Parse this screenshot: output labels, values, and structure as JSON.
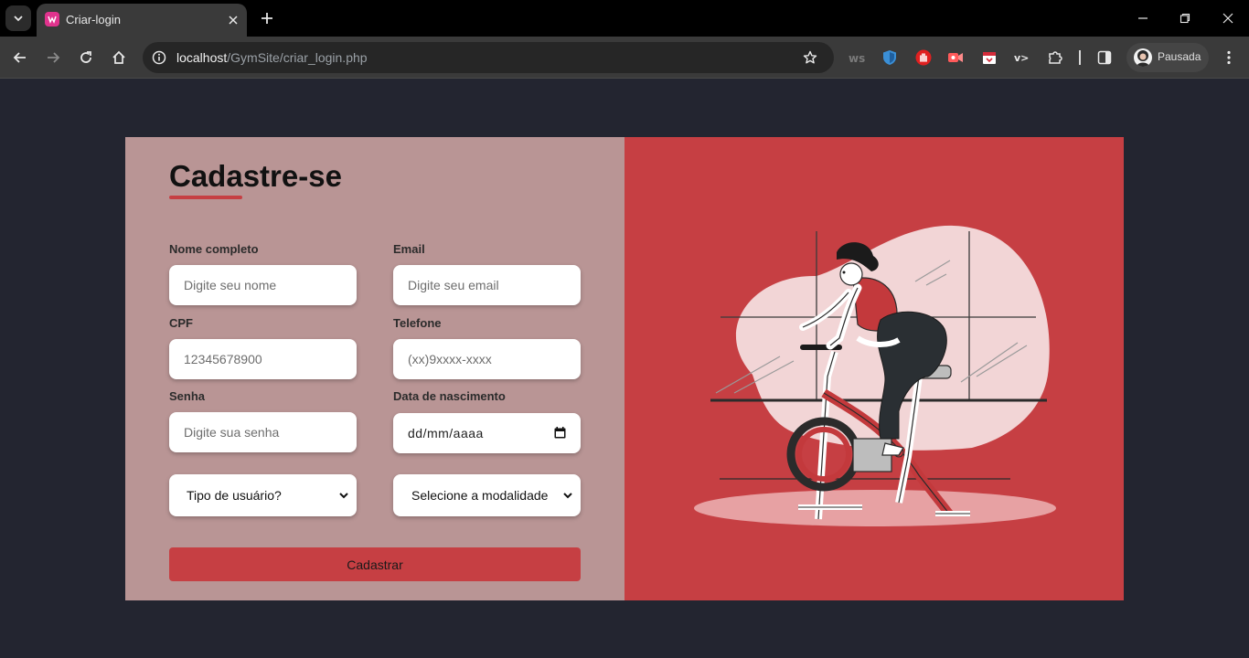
{
  "browser": {
    "tab_title": "Criar-login",
    "url_host": "localhost",
    "url_path": "/GymSite/criar_login.php",
    "profile_label": "Pausada",
    "extensions": [
      "ws-icon",
      "shield-icon",
      "stop-hand-icon",
      "video-record-icon",
      "calendar-extension-icon",
      "vscode-icon",
      "puzzle-icon"
    ]
  },
  "form": {
    "title": "Cadastre-se",
    "fields": [
      {
        "label": "Nome completo",
        "placeholder": "Digite seu nome"
      },
      {
        "label": "Email",
        "placeholder": "Digite seu email"
      },
      {
        "label": "CPF",
        "placeholder": "12345678900"
      },
      {
        "label": "Telefone",
        "placeholder": "(xx)9xxxx-xxxx"
      },
      {
        "label": "Senha",
        "placeholder": "Digite sua senha"
      },
      {
        "label": "Data de nascimento",
        "placeholder": "dd/mm/aaaa"
      }
    ],
    "selects": [
      {
        "selected": "Tipo de usuário?"
      },
      {
        "selected": "Selecione a modalidade"
      }
    ],
    "submit_label": "Cadastrar"
  },
  "colors": {
    "page_bg": "#232530",
    "form_panel": "#b99595",
    "accent": "#c63f43"
  }
}
